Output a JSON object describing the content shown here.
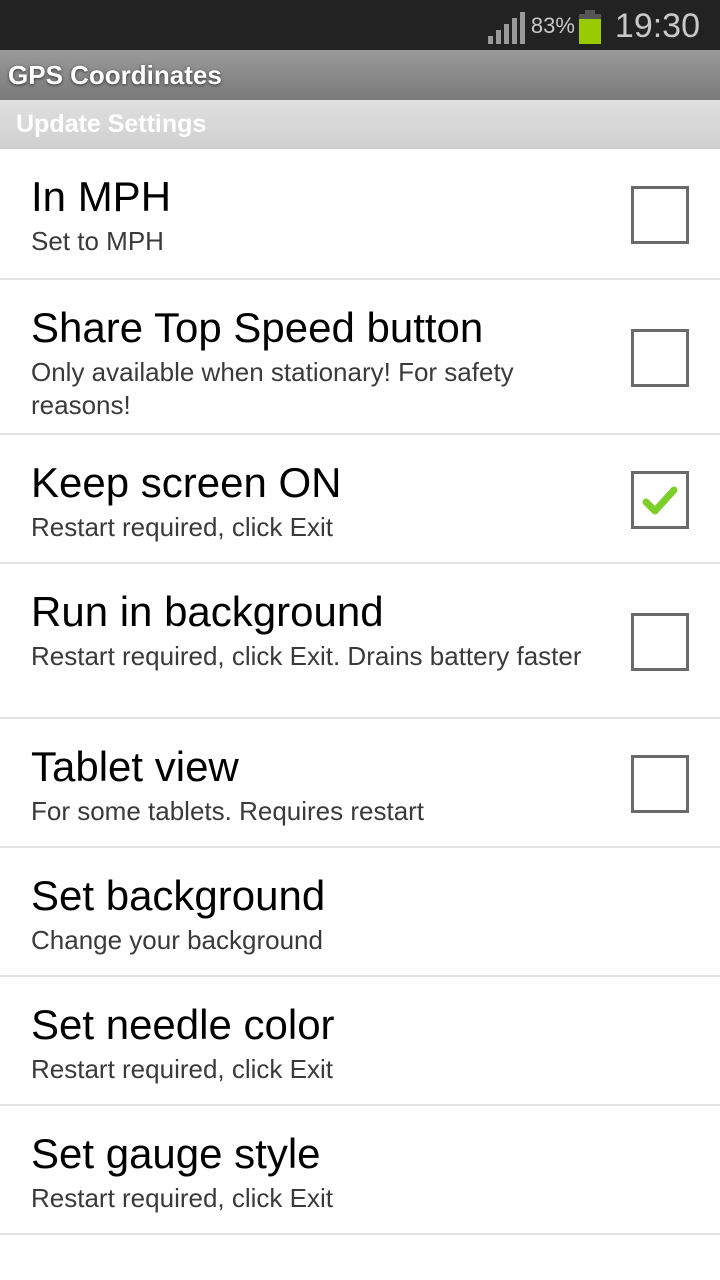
{
  "status_bar": {
    "signal_icon": "signal-bars-icon",
    "battery_percent": "83%",
    "battery_icon": "battery-icon",
    "battery_level": 0.83,
    "time": "19:30"
  },
  "app": {
    "title": "GPS Coordinates",
    "section_header": "Update Settings"
  },
  "colors": {
    "battery_green": "#99cc00",
    "check_green": "#7ccf2a"
  },
  "preferences": [
    {
      "title": "In MPH",
      "summary": "Set to MPH",
      "checkbox": true,
      "checked": false
    },
    {
      "title": "Share Top Speed button",
      "summary": "Only available when stationary! For safety reasons!",
      "checkbox": true,
      "checked": false
    },
    {
      "title": "Keep screen ON",
      "summary": "Restart required, click Exit",
      "checkbox": true,
      "checked": true
    },
    {
      "title": "Run in background",
      "summary": "Restart required, click Exit. Drains battery faster",
      "checkbox": true,
      "checked": false
    },
    {
      "title": "Tablet view",
      "summary": "For some tablets. Requires restart",
      "checkbox": true,
      "checked": false
    },
    {
      "title": "Set background",
      "summary": "Change your background",
      "checkbox": false
    },
    {
      "title": "Set needle color",
      "summary": "Restart required, click Exit",
      "checkbox": false
    },
    {
      "title": "Set gauge style",
      "summary": "Restart required, click Exit",
      "checkbox": false
    }
  ]
}
